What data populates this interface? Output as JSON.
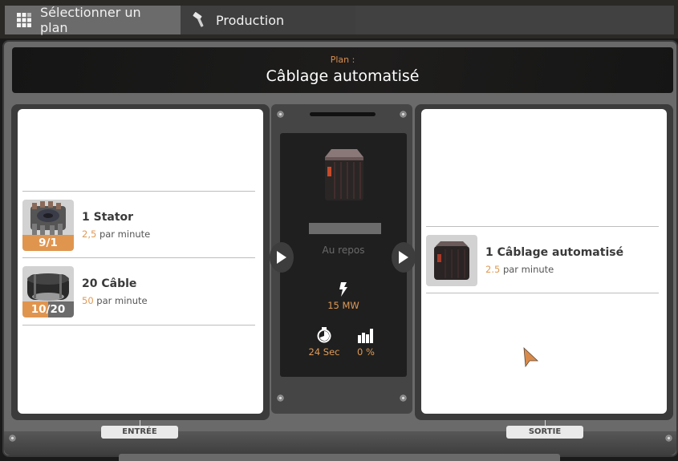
{
  "tabs": [
    {
      "label": "Sélectionner un plan",
      "icon": "grid-icon",
      "active": true
    },
    {
      "label": "Production",
      "icon": "hammer-icon",
      "active": false
    }
  ],
  "plan": {
    "label": "Plan :",
    "name": "Câblage automatisé"
  },
  "inputs": {
    "section_label": "ENTRÉE",
    "items": [
      {
        "name": "1 Stator",
        "rate": "2,5",
        "rate_suffix": "par minute",
        "stock": "9/1",
        "fill_fraction": 1.0,
        "icon": "stator-icon"
      },
      {
        "name": "20 Câble",
        "rate": "50",
        "rate_suffix": "par minute",
        "stock": "10/20",
        "fill_fraction": 0.5,
        "icon": "cable-icon"
      }
    ]
  },
  "machine": {
    "icon": "automated-wiring-icon",
    "progress_fraction": 0,
    "status": "Au repos",
    "power": "15 MW",
    "cycle_time": "24 Sec",
    "productivity": "0 %"
  },
  "outputs": {
    "section_label": "SORTIE",
    "items": [
      {
        "name": "1 Câblage automatisé",
        "rate": "2.5",
        "rate_suffix": "par minute",
        "icon": "automated-wiring-icon"
      }
    ]
  },
  "colors": {
    "accent": "#e0954f",
    "badge_empty": "#6b6b6b",
    "panel_dark": "#1f1f1f"
  }
}
